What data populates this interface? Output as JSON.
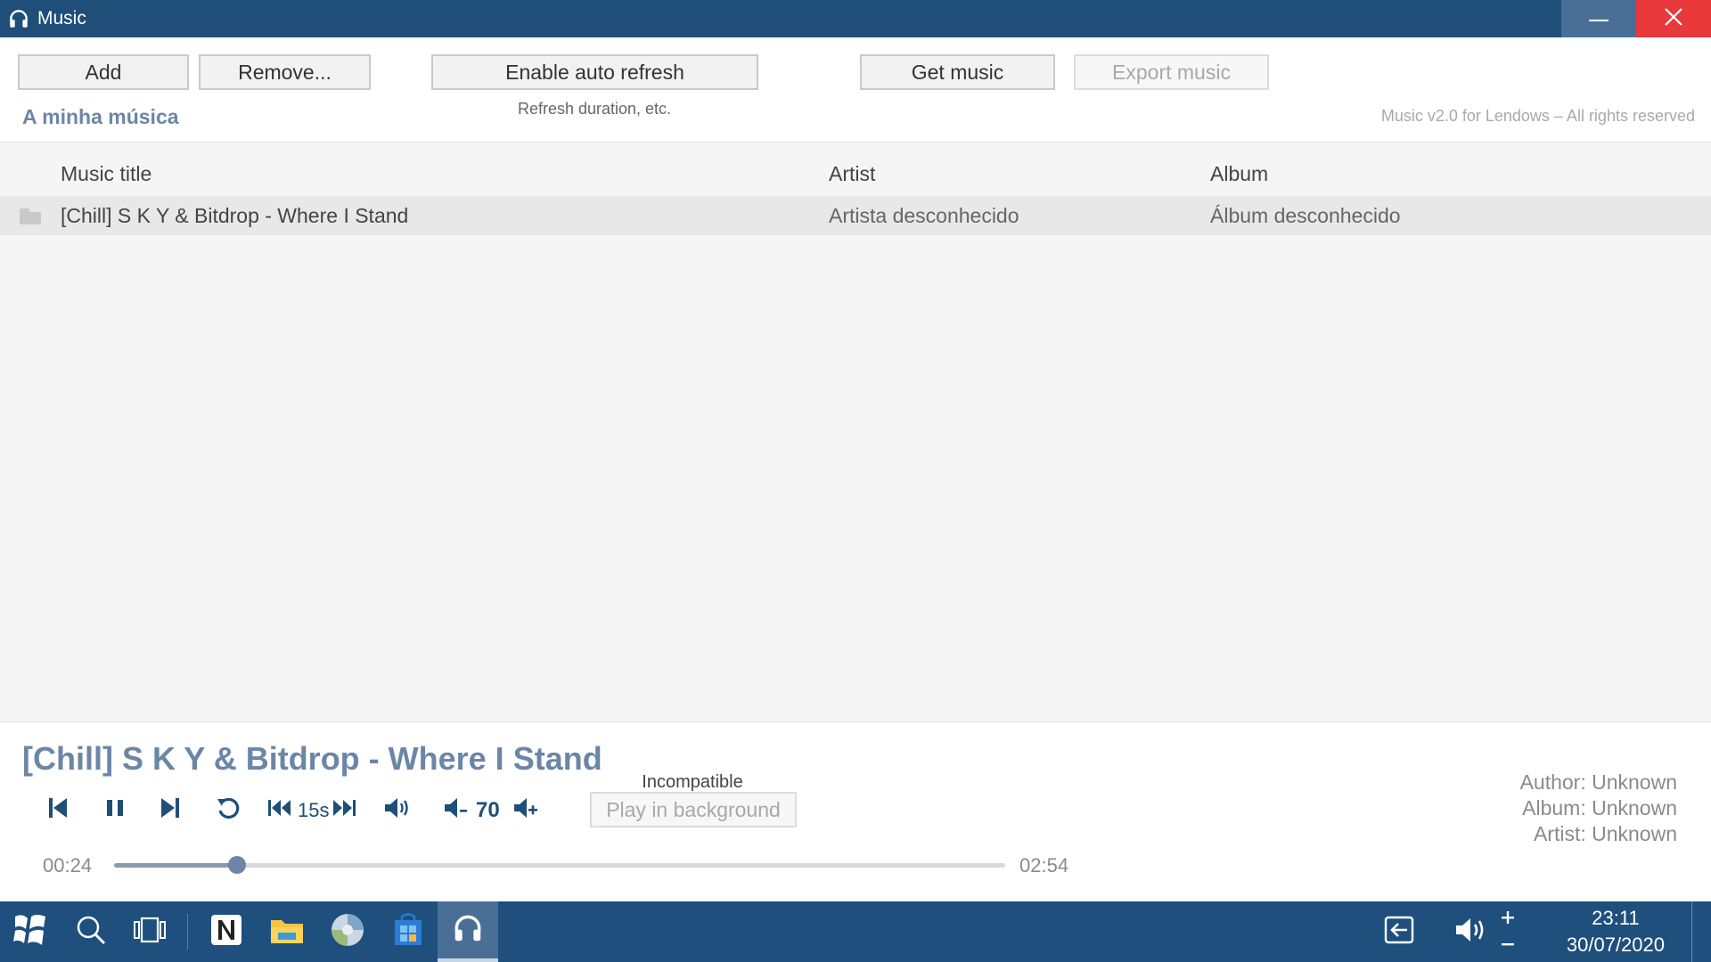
{
  "window": {
    "title": "Music",
    "app_icon": "headphones-icon",
    "minimize_icon": "minimize-icon",
    "close_icon": "close-icon"
  },
  "toolbar": {
    "add_label": "Add",
    "remove_label": "Remove...",
    "auto_refresh_label": "Enable auto refresh",
    "refresh_note": "Refresh duration, etc.",
    "get_music_label": "Get music",
    "export_music_label": "Export music",
    "section_title": "A minha música",
    "rights": "Music v2.0 for Lendows – All rights reserved"
  },
  "list": {
    "columns": {
      "title": "Music title",
      "artist": "Artist",
      "album": "Album"
    },
    "rows": [
      {
        "icon": "folder-icon",
        "title": "[Chill] S K Y & Bitdrop - Where I Stand",
        "artist": "Artista desconhecido",
        "album": "Álbum desconhecido"
      }
    ]
  },
  "player": {
    "now_playing": "[Chill] S K Y & Bitdrop - Where I Stand",
    "skip_label": "15s",
    "volume": "70",
    "incompatible_label": "Incompatible",
    "background_label": "Play in background",
    "author": "Author: Unknown",
    "album": "Album: Unknown",
    "artist": "Artist: Unknown",
    "elapsed": "00:24",
    "duration": "02:54",
    "progress_fraction": 0.138
  },
  "taskbar": {
    "clock_time": "23:11",
    "clock_date": "30/07/2020",
    "icons": [
      "start-icon",
      "search-icon",
      "task-view-icon",
      "notes-app-icon",
      "file-explorer-icon",
      "browser-icon",
      "store-icon",
      "music-app-icon"
    ],
    "tray_icons": [
      "input-switch-icon",
      "speaker-icon",
      "volume-plus-icon",
      "volume-minus-icon"
    ]
  },
  "colors": {
    "accent": "#1f4e79",
    "title_text": "#6b86a6",
    "close": "#e8383a"
  }
}
